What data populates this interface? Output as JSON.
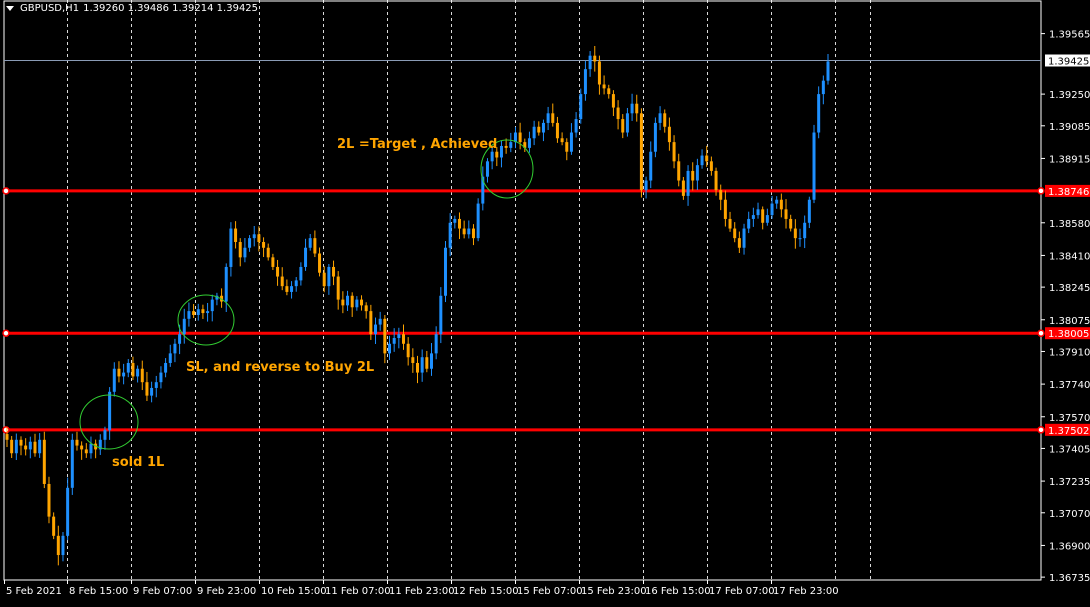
{
  "header": {
    "symbol_timeframe": "GBPUSD,H1",
    "ohlc": "1.39260 1.39486 1.39214 1.39425"
  },
  "colors": {
    "background": "#000000",
    "bull": "#1e90ff",
    "bear": "#ffa500",
    "grid": "#ffffff",
    "level_line": "#ff0000",
    "annotation_text": "#ffa500",
    "circle": "#32cd32",
    "price_line": "#8a9bb5"
  },
  "chart_data": {
    "type": "candlestick",
    "title": "",
    "ylim": [
      1.3672,
      1.3974
    ],
    "y_ticks": [
      "1.39565",
      "1.39250",
      "1.39085",
      "1.38915",
      "1.38580",
      "1.38410",
      "1.38245",
      "1.38075",
      "1.37910",
      "1.37740",
      "1.37570",
      "1.37405",
      "1.37235",
      "1.37070",
      "1.36900",
      "1.36735"
    ],
    "x_ticks": [
      "5 Feb 2021",
      "8 Feb 15:00",
      "9 Feb 07:00",
      "9 Feb 23:00",
      "10 Feb 15:00",
      "11 Feb 07:00",
      "11 Feb 23:00",
      "12 Feb 15:00",
      "15 Feb 07:00",
      "15 Feb 23:00",
      "16 Feb 15:00",
      "17 Feb 07:00",
      "17 Feb 23:00"
    ],
    "current_price": "1.39425",
    "levels": [
      {
        "price": 1.38746,
        "label": "1.38746"
      },
      {
        "price": 1.38005,
        "label": "1.38005"
      },
      {
        "price": 1.37502,
        "label": "1.37502"
      }
    ],
    "annotations": [
      {
        "text": "2L =Target , Achieved"
      },
      {
        "text": "SL, and reverse  to Buy 2L"
      },
      {
        "text": "sold 1L"
      }
    ],
    "closes": [
      1.3745,
      1.3738,
      1.3745,
      1.3742,
      1.374,
      1.3744,
      1.3738,
      1.3745,
      1.3722,
      1.3705,
      1.3695,
      1.3685,
      1.3695,
      1.372,
      1.3745,
      1.3742,
      1.374,
      1.3738,
      1.3743,
      1.374,
      1.3745,
      1.375,
      1.377,
      1.3782,
      1.3778,
      1.378,
      1.3785,
      1.3778,
      1.3782,
      1.3775,
      1.3768,
      1.3772,
      1.3775,
      1.378,
      1.3785,
      1.379,
      1.3795,
      1.38,
      1.3808,
      1.3812,
      1.381,
      1.3813,
      1.3811,
      1.3812,
      1.3818,
      1.382,
      1.3817,
      1.3835,
      1.3855,
      1.3848,
      1.384,
      1.3845,
      1.385,
      1.3852,
      1.3848,
      1.3845,
      1.384,
      1.3835,
      1.383,
      1.3825,
      1.3822,
      1.3825,
      1.3828,
      1.3835,
      1.3845,
      1.385,
      1.3842,
      1.3832,
      1.3825,
      1.3835,
      1.383,
      1.3818,
      1.3815,
      1.382,
      1.3814,
      1.3818,
      1.3815,
      1.3812,
      1.38,
      1.3805,
      1.3808,
      1.379,
      1.3795,
      1.3798,
      1.38,
      1.3795,
      1.3788,
      1.3785,
      1.378,
      1.3788,
      1.3782,
      1.379,
      1.38,
      1.382,
      1.3845,
      1.3858,
      1.386,
      1.3855,
      1.3852,
      1.3855,
      1.385,
      1.3868,
      1.3882,
      1.389,
      1.3895,
      1.3892,
      1.3898,
      1.3897,
      1.39,
      1.3905,
      1.39,
      1.3897,
      1.3902,
      1.3908,
      1.3905,
      1.391,
      1.3915,
      1.391,
      1.3902,
      1.39,
      1.3895,
      1.3905,
      1.3912,
      1.3925,
      1.3938,
      1.3945,
      1.3942,
      1.393,
      1.3928,
      1.3925,
      1.3918,
      1.3912,
      1.3905,
      1.3915,
      1.392,
      1.3915,
      1.3875,
      1.388,
      1.3895,
      1.391,
      1.3915,
      1.3908,
      1.39,
      1.389,
      1.388,
      1.3872,
      1.3885,
      1.388,
      1.3888,
      1.3893,
      1.389,
      1.3885,
      1.3875,
      1.387,
      1.386,
      1.3855,
      1.385,
      1.3845,
      1.3855,
      1.386,
      1.3862,
      1.3865,
      1.3858,
      1.3862,
      1.3868,
      1.387,
      1.3865,
      1.386,
      1.3855,
      1.385,
      1.385,
      1.3858,
      1.387,
      1.3905,
      1.3925,
      1.3932,
      1.3942
    ]
  }
}
